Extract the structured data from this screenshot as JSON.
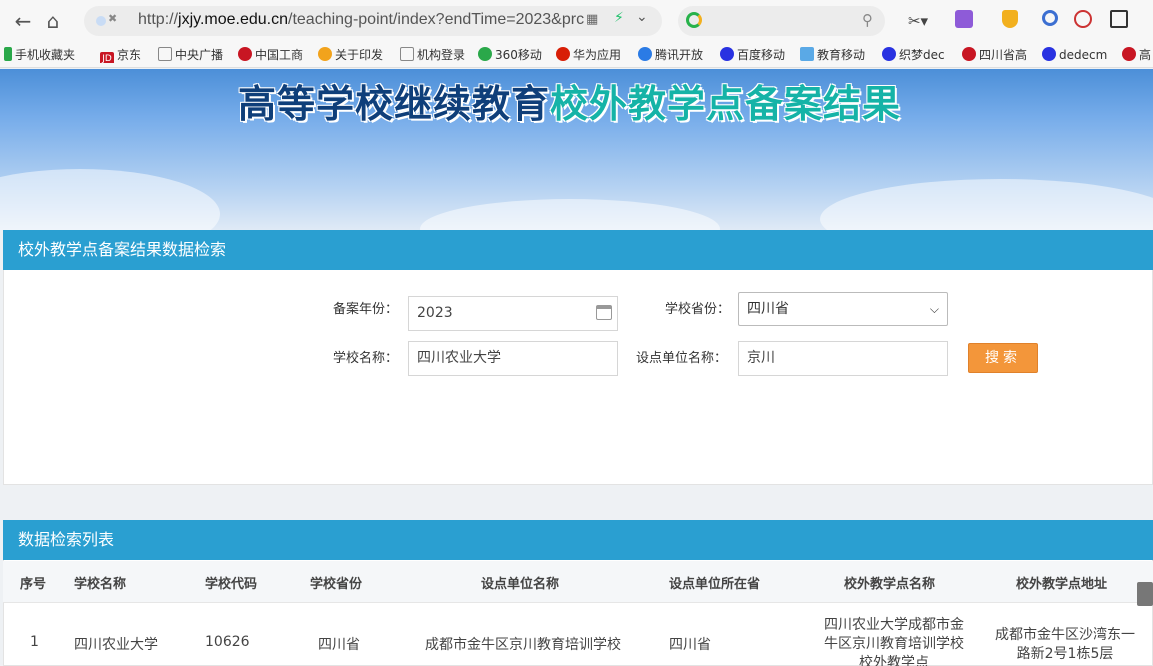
{
  "browser": {
    "url_prefix": "http://",
    "url_host": "jxjy.moe.edu.cn",
    "url_path": "/teaching-point/index?endTime=2023&prc",
    "bookmarks": [
      "手机收藏夹",
      "京东",
      "中央广播",
      "中国工商",
      "关于印发",
      "机构登录",
      "360移动",
      "华为应用",
      "腾讯开放",
      "百度移动",
      "教育移动",
      "织梦dec",
      "四川省高",
      "dedecm",
      "高"
    ]
  },
  "page": {
    "banner_title_part1": "高等学校继续教育",
    "banner_title_part2": "校外教学点备案结果"
  },
  "search_panel": {
    "title": "校外教学点备案结果数据检索",
    "year_label": "备案年份：",
    "year_value": "2023",
    "province_label": "学校省份：",
    "province_value": "四川省",
    "school_label": "学校名称：",
    "school_value": "四川农业大学",
    "unit_label": "设点单位名称：",
    "unit_value": "京川",
    "search_button": "搜索"
  },
  "results_panel": {
    "title": "数据检索列表",
    "columns": [
      "序号",
      "学校名称",
      "学校代码",
      "学校省份",
      "设点单位名称",
      "设点单位所在省",
      "校外教学点名称",
      "校外教学点地址"
    ],
    "rows": [
      [
        "1",
        "四川农业大学",
        "10626",
        "四川省",
        "成都市金牛区京川教育培训学校",
        "四川省",
        "四川农业大学成都市金牛区京川教育培训学校校外教学点",
        "成都市金牛区沙湾东一路新2号1栋5层"
      ]
    ]
  },
  "colors": {
    "panel_header": "#2a9fd1",
    "search_button": "#f3963a",
    "title_dark": "#0f3f7a",
    "title_teal": "#15b3a7"
  }
}
